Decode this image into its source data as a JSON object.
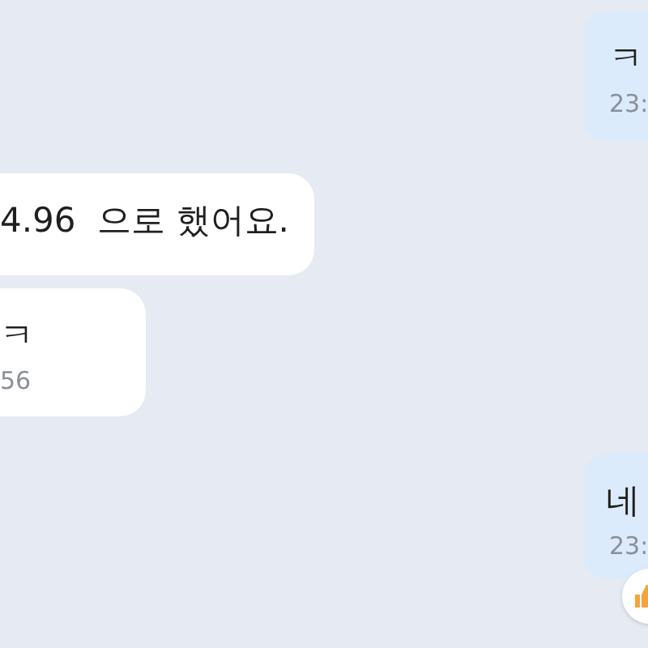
{
  "messages": [
    {
      "kind": "sent",
      "text": "ㅋ",
      "time": "23:",
      "reacted": false
    },
    {
      "kind": "received",
      "text": "4.96  으로 했어요.",
      "reacted": false
    },
    {
      "kind": "received",
      "text": "ㅋ",
      "time": "56",
      "reacted": false
    },
    {
      "kind": "sent",
      "text": "네",
      "time": "23:",
      "reacted": true
    }
  ]
}
